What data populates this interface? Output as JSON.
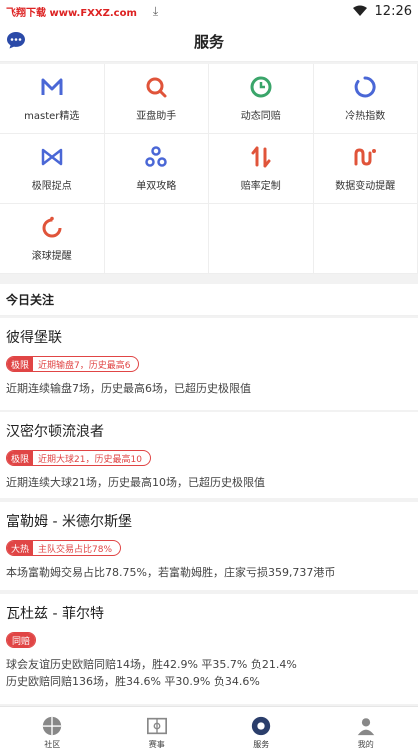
{
  "statusbar": {
    "watermark": "飞翔下载 www.FXXZ.com",
    "time": "12:26"
  },
  "header": {
    "title": "服务"
  },
  "services": [
    {
      "label": "master精选",
      "icon": "master-m-icon",
      "color": "#4a67d6"
    },
    {
      "label": "亚盘助手",
      "icon": "search-ring-icon",
      "color": "#e0543a"
    },
    {
      "label": "动态同赔",
      "icon": "clock-icon",
      "color": "#3aa56a"
    },
    {
      "label": "冷热指数",
      "icon": "ring-icon",
      "color": "#4a67d6"
    },
    {
      "label": "极限捉点",
      "icon": "bowtie-icon",
      "color": "#4a67d6"
    },
    {
      "label": "单双攻略",
      "icon": "three-dots-icon",
      "color": "#4a67d6"
    },
    {
      "label": "赔率定制",
      "icon": "up-down-arrows-icon",
      "color": "#e0543a"
    },
    {
      "label": "数据变动提醒",
      "icon": "wave-icon",
      "color": "#e0543a"
    },
    {
      "label": "滚球提醒",
      "icon": "dashed-ring-icon",
      "color": "#e0543a"
    }
  ],
  "today": {
    "title": "今日关注"
  },
  "cards": [
    {
      "name": "彼得堡联",
      "tag_key": "极限",
      "tag_value": "近期输盘7，历史最高6",
      "lines": [
        "近期连续输盘7场，历史最高6场，已超历史极限值"
      ]
    },
    {
      "name": "汉密尔顿流浪者",
      "tag_key": "极限",
      "tag_value": "近期大球21，历史最高10",
      "lines": [
        "近期连续大球21场，历史最高10场，已超历史极限值"
      ]
    },
    {
      "name": "富勒姆 - 米德尔斯堡",
      "tag_key": "大热",
      "tag_value": "主队交易占比78%",
      "lines": [
        "本场富勒姆交易占比78.75%，若富勒姆胜，庄家亏损359,737港币"
      ]
    },
    {
      "name": "瓦杜兹 - 菲尔特",
      "tag_key": "同赔",
      "tag_value": "",
      "lines": [
        "球会友谊历史欧赔同赔14场，胜42.9% 平35.7% 负21.4%",
        "历史欧赔同赔136场，胜34.6% 平30.9% 负34.6%"
      ]
    }
  ],
  "tabs": [
    {
      "label": "社区",
      "icon": "community-icon"
    },
    {
      "label": "赛事",
      "icon": "match-icon"
    },
    {
      "label": "服务",
      "icon": "service-icon"
    },
    {
      "label": "我的",
      "icon": "profile-icon"
    }
  ]
}
